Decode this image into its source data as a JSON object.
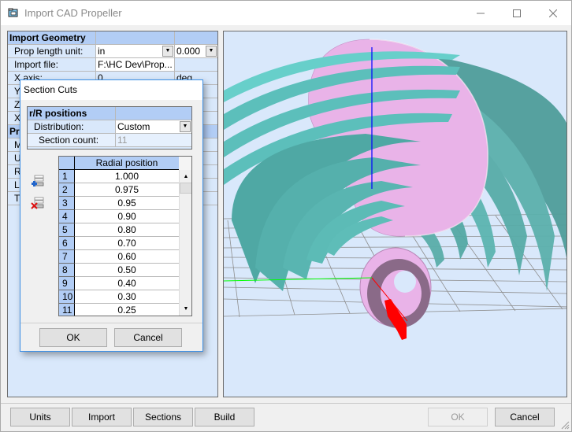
{
  "window": {
    "title": "Import CAD Propeller",
    "controls": {
      "minimize": "—",
      "maximize": "☐",
      "close": "✕"
    }
  },
  "property_grid": {
    "header": "Import Geometry",
    "rows": [
      {
        "label": "Prop length unit:",
        "value": "in",
        "extra": "0.000"
      },
      {
        "label": "Import file:",
        "value": "F:\\HC Dev\\Prop...",
        "extra": ""
      },
      {
        "label": "X axis:",
        "value": "0",
        "extra": "deg"
      },
      {
        "label": "Y",
        "value": "",
        "extra": ""
      },
      {
        "label": "Z",
        "value": "",
        "extra": ""
      },
      {
        "label": "X",
        "value": "",
        "extra": ""
      }
    ],
    "header2": "Pr",
    "rows2": [
      {
        "label": "M"
      },
      {
        "label": "U"
      },
      {
        "label": "R"
      },
      {
        "label": "L"
      },
      {
        "label": "T"
      }
    ]
  },
  "dialog": {
    "title": "Section Cuts",
    "rr_positions": {
      "header": "r/R positions",
      "distribution_label": "Distribution:",
      "distribution_value": "Custom",
      "section_count_label": "Section count:",
      "section_count_value": "11"
    },
    "table": {
      "column_header": "Radial position",
      "rows": [
        {
          "n": "1",
          "v": "1.000"
        },
        {
          "n": "2",
          "v": "0.975"
        },
        {
          "n": "3",
          "v": "0.95"
        },
        {
          "n": "4",
          "v": "0.90"
        },
        {
          "n": "5",
          "v": "0.80"
        },
        {
          "n": "6",
          "v": "0.70"
        },
        {
          "n": "7",
          "v": "0.60"
        },
        {
          "n": "8",
          "v": "0.50"
        },
        {
          "n": "9",
          "v": "0.40"
        },
        {
          "n": "10",
          "v": "0.30"
        },
        {
          "n": "11",
          "v": "0.25"
        }
      ]
    },
    "buttons": {
      "ok": "OK",
      "cancel": "Cancel"
    }
  },
  "bottom_bar": {
    "units": "Units",
    "import": "Import",
    "sections": "Sections",
    "build": "Build",
    "ok": "OK",
    "cancel": "Cancel"
  },
  "viewport": {
    "colors": {
      "background": "#d9e8fb",
      "blade": "#e9b3e8",
      "sections": "#5fbfbb",
      "z_axis": "#0000ff",
      "y_axis": "#00ff00",
      "x_axis": "#ff0000",
      "grid": "#8f8f8f"
    }
  }
}
